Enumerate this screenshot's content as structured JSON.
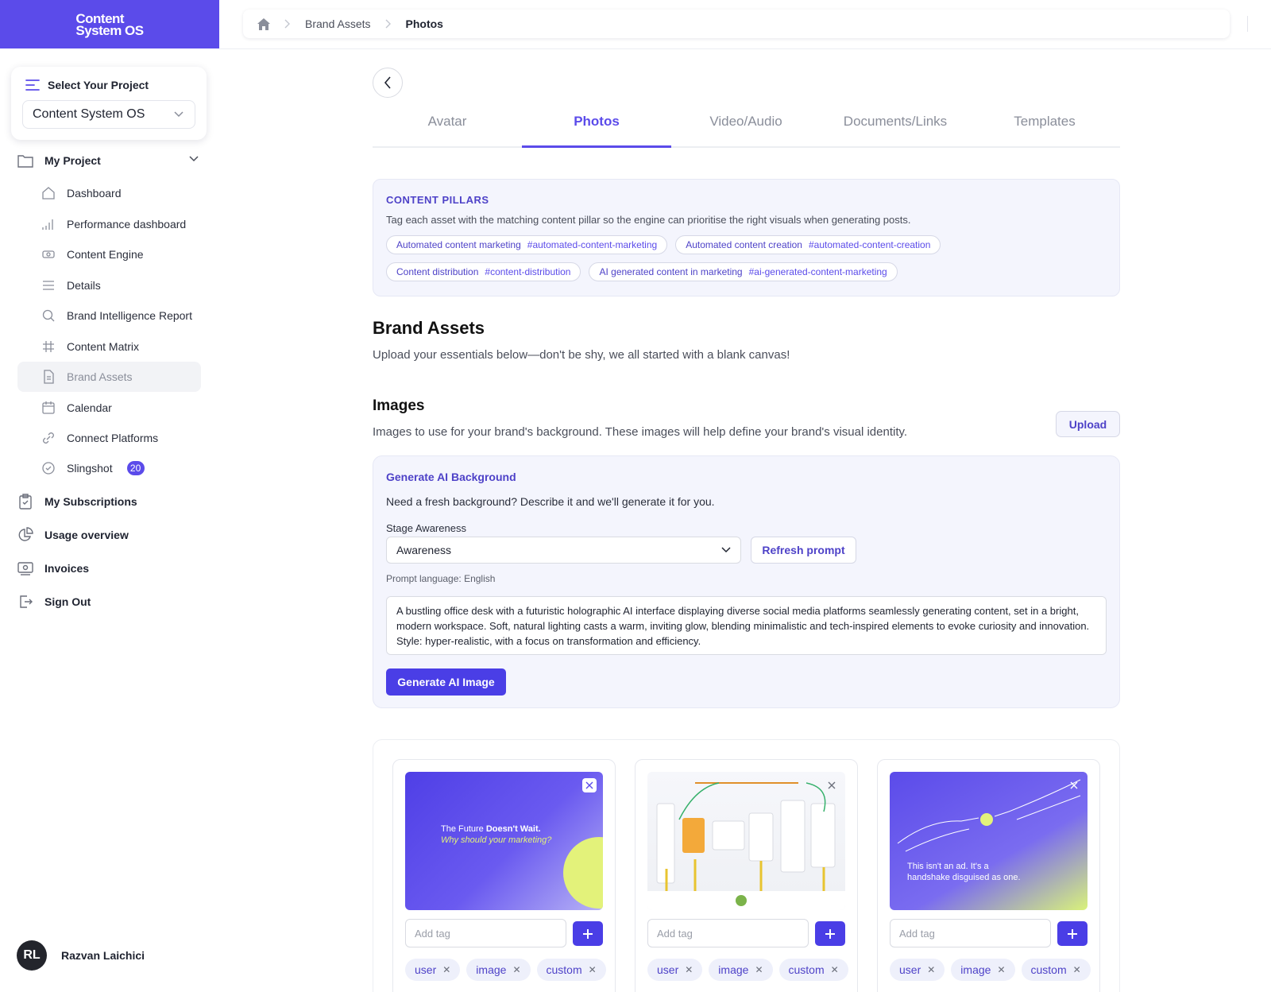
{
  "logo": {
    "line1": "Content",
    "line2": "System OS"
  },
  "project_selector": {
    "heading": "Select Your Project",
    "value": "Content System OS"
  },
  "sidebar": {
    "my_project": "My Project",
    "items": [
      {
        "label": "Dashboard",
        "icon": "home-icon"
      },
      {
        "label": "Performance dashboard",
        "icon": "bar-chart-icon"
      },
      {
        "label": "Content Engine",
        "icon": "engine-icon"
      },
      {
        "label": "Details",
        "icon": "list-icon"
      },
      {
        "label": "Brand Intelligence Report",
        "icon": "search-icon"
      },
      {
        "label": "Content Matrix",
        "icon": "hash-icon"
      },
      {
        "label": "Brand Assets",
        "icon": "document-icon",
        "active": true
      },
      {
        "label": "Calendar",
        "icon": "calendar-icon"
      },
      {
        "label": "Connect Platforms",
        "icon": "link-icon"
      },
      {
        "label": "Slingshot",
        "icon": "check-circle-icon",
        "badge": "20"
      }
    ],
    "groups": [
      "My Subscriptions",
      "Usage overview",
      "Invoices",
      "Sign Out"
    ]
  },
  "user": {
    "initials": "RL",
    "name": "Razvan Laichici"
  },
  "breadcrumb": {
    "home_icon": "home-icon",
    "section": "Brand Assets",
    "current": "Photos"
  },
  "tabs": [
    {
      "label": "Avatar"
    },
    {
      "label": "Photos",
      "active": true
    },
    {
      "label": "Video/Audio"
    },
    {
      "label": "Documents/Links"
    },
    {
      "label": "Templates"
    }
  ],
  "pillars": {
    "title": "CONTENT PILLARS",
    "description": "Tag each asset with the matching content pillar so the engine can prioritise the right visuals when generating posts.",
    "chips": [
      {
        "name": "Automated content marketing",
        "tag": "#automated-content-marketing"
      },
      {
        "name": "Automated content creation",
        "tag": "#automated-content-creation"
      },
      {
        "name": "Content distribution",
        "tag": "#content-distribution"
      },
      {
        "name": "AI generated content in marketing",
        "tag": "#ai-generated-content-marketing"
      }
    ]
  },
  "brand_assets": {
    "title": "Brand Assets",
    "subtitle": "Upload your essentials below—don't be shy, we all started with a blank canvas!"
  },
  "images": {
    "title": "Images",
    "subtitle": "Images to use for your brand's background. These images will help define your brand's visual identity.",
    "upload_label": "Upload"
  },
  "generator": {
    "title": "Generate AI Background",
    "description": "Need a fresh background? Describe it and we'll generate it for you.",
    "stage_label": "Stage Awareness",
    "stage_value": "Awareness",
    "refresh_label": "Refresh prompt",
    "language": "Prompt language: English",
    "prompt": "A bustling office desk with a futuristic holographic AI interface displaying diverse social media platforms seamlessly generating content, set in a bright, modern workspace. Soft, natural lighting casts a warm, inviting glow, blending minimalistic and tech-inspired elements to evoke curiosity and innovation. Style: hyper-realistic, with a focus on transformation and efficiency.",
    "generate_label": "Generate AI Image"
  },
  "gallery": {
    "tag_placeholder": "Add tag",
    "cards": [
      {
        "line1a": "The Future ",
        "line1b": "Doesn't Wait.",
        "line2": "Why should your marketing?",
        "tags": [
          "user",
          "image",
          "custom"
        ]
      },
      {
        "tags": [
          "user",
          "image",
          "custom"
        ]
      },
      {
        "line1": "This isn't an ad. It's a",
        "line2": "handshake disguised as one.",
        "tags": [
          "user",
          "image",
          "custom"
        ]
      }
    ]
  },
  "colors": {
    "accent": "#5b4bea",
    "accent_dark": "#4a3ee6",
    "panel": "#f4f5fd",
    "highlight": "#e3f27a"
  }
}
